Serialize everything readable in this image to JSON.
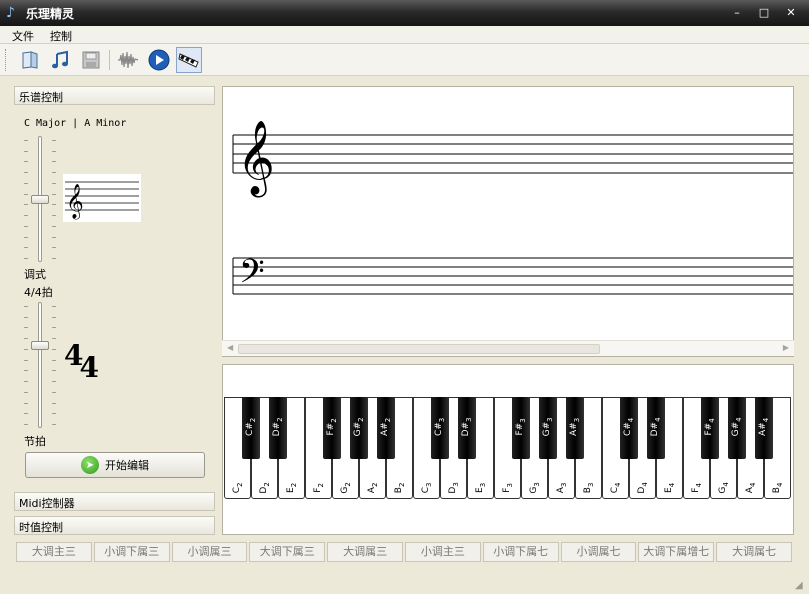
{
  "window": {
    "title": "乐理精灵",
    "minimize": "–",
    "maximize": "□",
    "close": "✕"
  },
  "menu": {
    "items": [
      "文件",
      "控制"
    ]
  },
  "toolbar": {
    "buttons": [
      {
        "icon": "open-book-icon"
      },
      {
        "icon": "music-notes-icon"
      },
      {
        "icon": "save-disk-icon"
      },
      {
        "icon": "waveform-icon"
      },
      {
        "icon": "play-icon"
      },
      {
        "icon": "piano-keys-icon"
      }
    ]
  },
  "left_panel": {
    "score_control_header": "乐谱控制",
    "key_display": "C Major | A Minor",
    "mode_label": "调式",
    "time_sig_display": "4/4拍",
    "time_sig_top": "4",
    "time_sig_bottom": "4",
    "beat_label": "节拍",
    "start_edit_button": "开始编辑",
    "midi_header": "Midi控制器",
    "duration_header": "时值控制",
    "key_slider_level": 0.5,
    "beat_slider_level": 0.67
  },
  "piano": {
    "white_keys": [
      "C",
      "D",
      "E",
      "F",
      "G",
      "A",
      "B",
      "C",
      "D",
      "E",
      "F",
      "G",
      "A",
      "B",
      "C",
      "D",
      "E",
      "F",
      "G",
      "A",
      "B"
    ],
    "white_octaves": [
      "2",
      "2",
      "2",
      "2",
      "2",
      "2",
      "2",
      "3",
      "3",
      "3",
      "3",
      "3",
      "3",
      "3",
      "4",
      "4",
      "4",
      "4",
      "4",
      "4",
      "4"
    ],
    "black_keys": [
      "C#",
      "D#",
      "F#",
      "G#",
      "A#",
      "C#",
      "D#",
      "F#",
      "G#",
      "A#",
      "C#",
      "D#",
      "F#",
      "G#",
      "A#"
    ],
    "black_octaves": [
      "2",
      "2",
      "2",
      "2",
      "2",
      "3",
      "3",
      "3",
      "3",
      "3",
      "4",
      "4",
      "4",
      "4",
      "4"
    ]
  },
  "chord_buttons": [
    "大调主三",
    "小调下属三",
    "小调属三",
    "大调下属三",
    "大调属三",
    "小调主三",
    "小调下属七",
    "小调属七",
    "大调下属增七",
    "大调属七"
  ]
}
